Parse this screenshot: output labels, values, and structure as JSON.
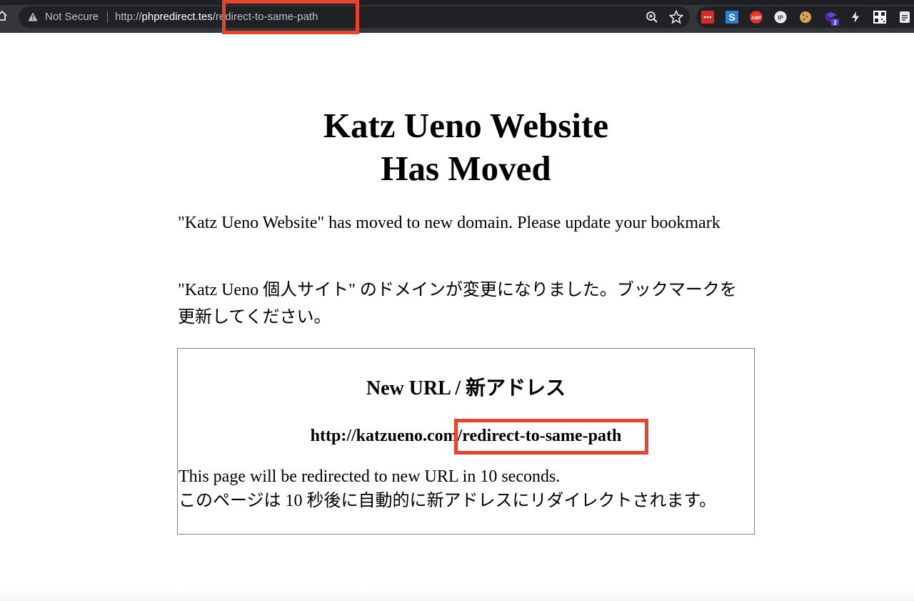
{
  "browser": {
    "security_label": "Not Secure",
    "url_scheme": "http://",
    "url_host": "phpredirect.tes",
    "url_path": "/redirect-to-same-path",
    "extensions": [
      {
        "name": "lastpass",
        "label": "•••"
      },
      {
        "name": "s-ext",
        "label": "S"
      },
      {
        "name": "adblock-plus",
        "label": "ABP"
      },
      {
        "name": "ip-ext",
        "label": "IP"
      },
      {
        "name": "cookie-ext",
        "label": ""
      },
      {
        "name": "badge-ext",
        "badge": "2"
      },
      {
        "name": "bolt-ext",
        "label": ""
      },
      {
        "name": "qr-ext",
        "label": ""
      },
      {
        "name": "doc-ext",
        "label": ""
      }
    ],
    "highlight_color": "#e8432f"
  },
  "page": {
    "title_line1": "Katz Ueno Website",
    "title_line2": "Has Moved",
    "notice_en": "\"Katz Ueno Website\" has moved to new domain. Please update your bookmark",
    "notice_ja": "\"Katz Ueno 個人サイト\" のドメインが変更になりました。ブックマークを更新してください。",
    "box": {
      "heading": "New URL / 新アドレス",
      "url_base": "http://katzueno.com",
      "url_path": "/redirect-to-same-path",
      "redirect_en": "This page will be redirected to new URL in 10 seconds.",
      "redirect_ja": "このページは 10 秒後に自動的に新アドレスにリダイレクトされます。"
    }
  }
}
